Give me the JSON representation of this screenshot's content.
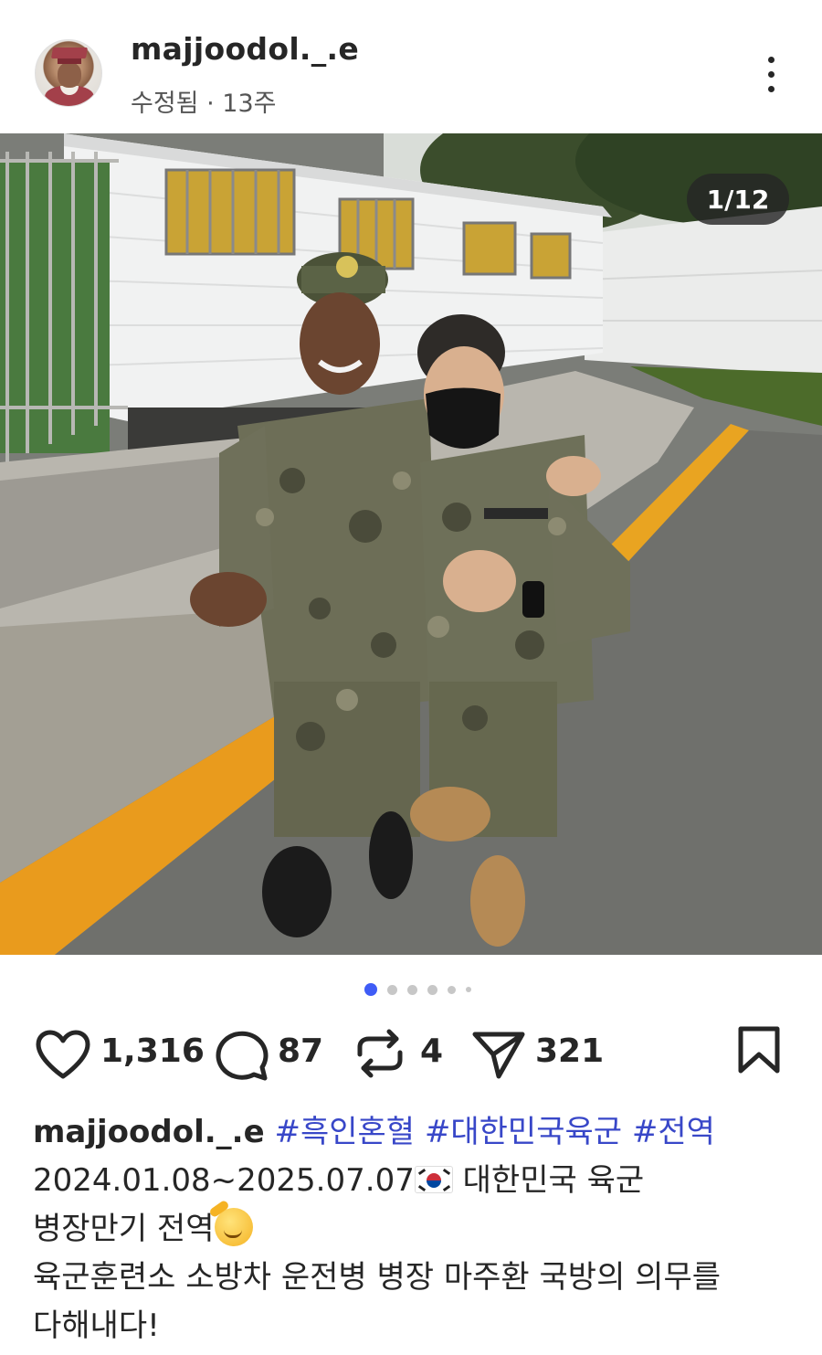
{
  "post": {
    "username": "majjoodol._.e",
    "meta": "수정됨 · 13주",
    "photo_counter": "1/12"
  },
  "carousel": {
    "dots": [
      {
        "active": true
      },
      {
        "active": false
      },
      {
        "active": false
      },
      {
        "active": false
      },
      {
        "active": false
      },
      {
        "active": false
      }
    ],
    "active_color": "#3f5cf6",
    "inactive_color": "#c7c7c7"
  },
  "actions": {
    "likes": "1,316",
    "comments": "87",
    "reposts": "4",
    "shares": "321"
  },
  "icons": {
    "like": "heart-icon",
    "comment": "comment-bubble-icon",
    "repost": "repost-arrows-icon",
    "share": "paper-plane-icon",
    "save": "bookmark-icon",
    "more": "more-options-icon"
  },
  "caption": {
    "username": "majjoodol._.e",
    "hashtags": [
      "#흑인혼혈",
      "#대한민국육군",
      "#전역"
    ],
    "line1": "2024.01.08~2025.07.07",
    "line1b": " 대한민국 육군",
    "line2": "병장만기 전역",
    "line3": "육군훈련소 소방차 운전병 병장 마주환 국방의 의무를",
    "line4": "다해내다!"
  },
  "colors": {
    "hashtag": "#3847c8",
    "text": "#262626",
    "muted": "#555555"
  }
}
